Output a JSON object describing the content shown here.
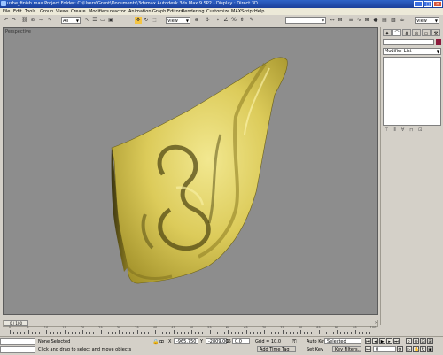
{
  "window": {
    "title": "uzhe_finish.max    Project Folder: C:\\Users\\Grant\\Documents\\3dsmax    Autodesk 3ds Max 9 SP2    - Display : Direct 3D",
    "buttons": [
      "_",
      "□",
      "×"
    ]
  },
  "menu": [
    "File",
    "Edit",
    "Tools",
    "Group",
    "Views",
    "Create",
    "Modifiers",
    "reactor",
    "Animation",
    "Graph Editors",
    "Rendering",
    "Customize",
    "MAXScript",
    "Help"
  ],
  "toolbar": {
    "selection_filter": "All",
    "ref_coord": "View",
    "named_selection": "",
    "render_dropdown": "View"
  },
  "viewport": {
    "label": "Perspective",
    "model": "ear"
  },
  "command_panel": {
    "tabs": [
      "create",
      "modify",
      "hierarchy",
      "motion",
      "display",
      "utilities"
    ],
    "object_name": "",
    "modifier_list": "Modifier List",
    "object_color": "#8b1a3c"
  },
  "timeline": {
    "frame_display": "0 / 100",
    "ticks": [
      "0",
      "5",
      "10",
      "15",
      "20",
      "25",
      "30",
      "35",
      "40",
      "45",
      "50",
      "55",
      "60",
      "65",
      "70",
      "75",
      "80",
      "85",
      "90",
      "95",
      "100"
    ]
  },
  "status": {
    "selection": "None Selected",
    "prompt": "Click and drag to select and move objects",
    "x": "-965.750",
    "y": "-2809.006",
    "z": "0.0",
    "grid": "Grid = 10.0",
    "auto_key": "Auto Key",
    "key_mode": "Selected",
    "set_key": "Set Key",
    "key_filters": "Key Filters...",
    "add_time_tag": "Add Time Tag",
    "current_frame": "0"
  }
}
